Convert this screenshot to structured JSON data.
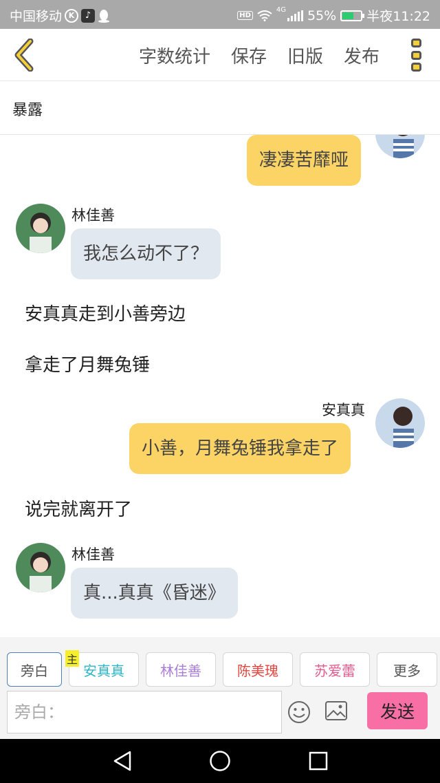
{
  "status_bar": {
    "carrier": "中国移动",
    "k_badge": "K",
    "hd": "HD",
    "network": "4G",
    "battery": "55%",
    "battery_level": 0.55,
    "time": "半夜11:22"
  },
  "header": {
    "actions": [
      "字数统计",
      "保存",
      "旧版",
      "发布"
    ]
  },
  "chapter": {
    "title": "暴露"
  },
  "chat": {
    "msg1_text": "凄凄苦靡哑",
    "msg2_name": "林佳善",
    "msg2_text": "我怎么动不了？",
    "narration1": "安真真走到小善旁边",
    "narration2": "拿走了月舞兔锤",
    "msg3_name": "安真真",
    "msg3_text": "小善，月舞兔锤我拿走了",
    "narration3": "说完就离开了",
    "msg4_name": "林佳善",
    "msg4_text": "真...真真《昏迷》"
  },
  "roles": {
    "main_badge": "主",
    "tabs": [
      {
        "label": "旁白",
        "color": "#555555"
      },
      {
        "label": "安真真",
        "color": "#2bb5c9"
      },
      {
        "label": "林佳善",
        "color": "#a97ed6"
      },
      {
        "label": "陈美瑰",
        "color": "#e0463f"
      },
      {
        "label": "苏爱蕾",
        "color": "#e05a8e"
      },
      {
        "label": "更多",
        "color": "#555555"
      }
    ]
  },
  "composer": {
    "placeholder": "旁白：",
    "send_label": "发送"
  },
  "colors": {
    "accent_yellow": "#fbd465",
    "send_pink": "#f86fa5",
    "left_bubble": "#e2e8f0"
  }
}
